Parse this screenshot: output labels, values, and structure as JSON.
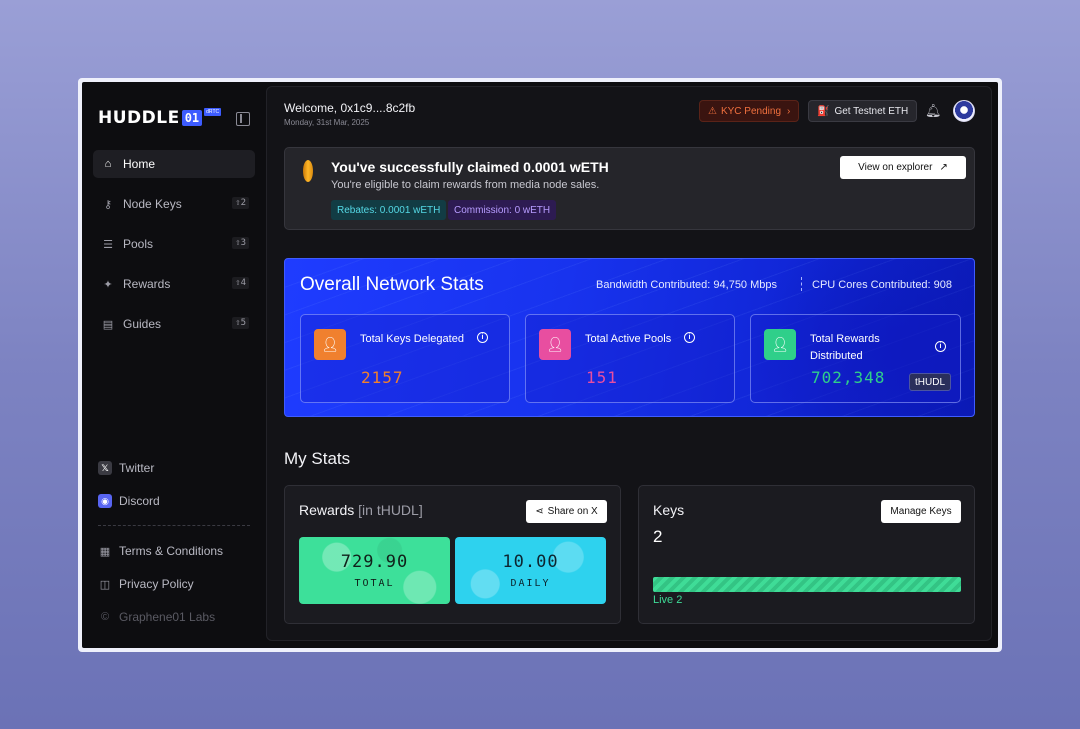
{
  "brand": {
    "name": "HUDDLE",
    "badge": "01",
    "tag": "dRTC"
  },
  "sidebar": {
    "items": [
      {
        "label": "Home",
        "icon": "home-icon",
        "shortcut": ""
      },
      {
        "label": "Node Keys",
        "icon": "key-icon",
        "shortcut": "⇧2"
      },
      {
        "label": "Pools",
        "icon": "database-icon",
        "shortcut": "⇧3"
      },
      {
        "label": "Rewards",
        "icon": "sparkle-icon",
        "shortcut": "⇧4"
      },
      {
        "label": "Guides",
        "icon": "book-icon",
        "shortcut": "⇧5"
      }
    ],
    "social": [
      {
        "label": "Twitter",
        "icon": "x-icon"
      },
      {
        "label": "Discord",
        "icon": "discord-icon"
      }
    ],
    "footer": [
      {
        "label": "Terms & Conditions"
      },
      {
        "label": "Privacy Policy"
      },
      {
        "label": "Graphene01 Labs"
      }
    ]
  },
  "header": {
    "welcome": "Welcome, 0x1c9....8c2fb",
    "date": "Monday, 31st Mar, 2025",
    "kyc_label": "KYC Pending",
    "testnet_label": "Get Testnet ETH"
  },
  "claim": {
    "title": "You've successfully claimed 0.0001 wETH",
    "subtitle": "You're eligible to claim rewards from media node sales.",
    "rebates": "Rebates: 0.0001 wETH",
    "commission": "Commission: 0 wETH",
    "explorer_label": "View on explorer"
  },
  "network": {
    "title": "Overall Network Stats",
    "bandwidth": "Bandwidth Contributed: 94,750 Mbps",
    "cpu": "CPU Cores Contributed: 908",
    "cards": [
      {
        "label": "Total Keys Delegated",
        "value": "2157",
        "color": "#f0802e"
      },
      {
        "label": "Total Active Pools",
        "value": "151",
        "color": "#e84ea0"
      },
      {
        "label": "Total Rewards Distributed",
        "value": "702,348",
        "color": "#2fcf8a",
        "unit": "tHUDL"
      }
    ]
  },
  "my_stats": {
    "title": "My Stats",
    "rewards": {
      "title": "Rewards",
      "unit": "[in tHUDL]",
      "share_label": "Share on X",
      "total_value": "729.90",
      "total_label": "TOTAL",
      "daily_value": "10.00",
      "daily_label": "DAILY"
    },
    "keys": {
      "title": "Keys",
      "count": "2",
      "manage_label": "Manage Keys",
      "live_label": "Live 2",
      "live_fraction": 1.0
    }
  }
}
